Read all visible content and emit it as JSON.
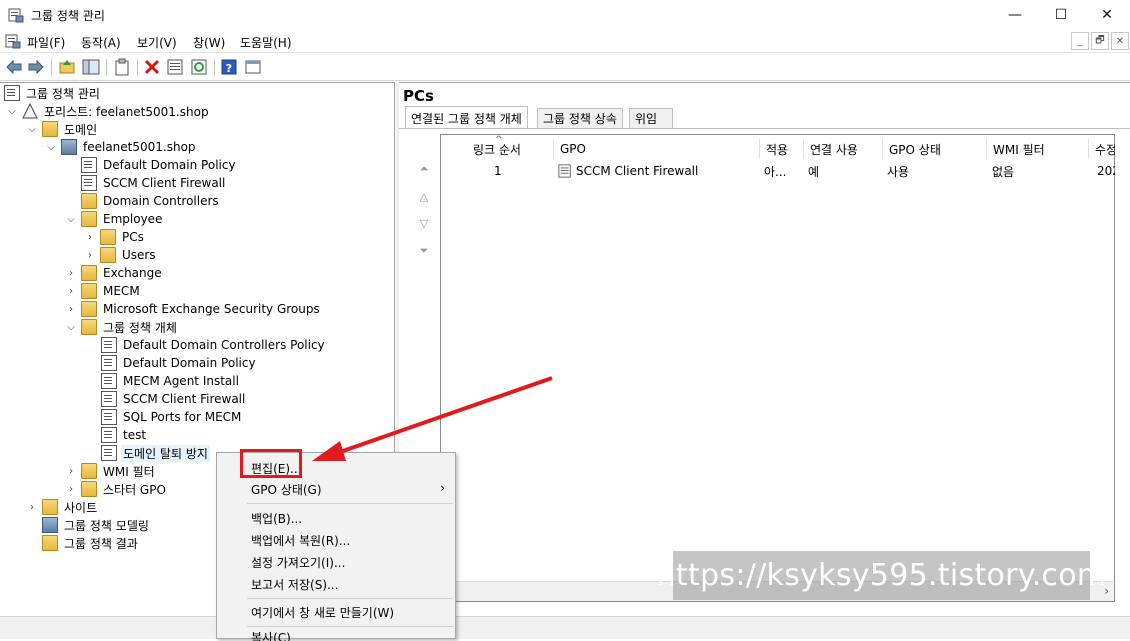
{
  "window": {
    "title": "그룹 정책 관리",
    "controls": {
      "minimize": "—",
      "maximize": "☐",
      "close": "✕"
    }
  },
  "menu": {
    "items": [
      "파일(F)",
      "동작(A)",
      "보기(V)",
      "창(W)",
      "도움말(H)"
    ],
    "mdi_controls": [
      "_",
      "🗗",
      "✕"
    ]
  },
  "toolbar": {
    "icons": [
      "back-icon",
      "forward-icon",
      "up-folder-icon",
      "show-hide-tree-icon",
      "clipboard-icon",
      "delete-icon",
      "properties-icon",
      "refresh-icon",
      "help-icon",
      "view-icon"
    ]
  },
  "tree": {
    "root": "그룹 정책 관리",
    "forest": "포리스트: feelanet5001.shop",
    "domains": "도메인",
    "domain": "feelanet5001.shop",
    "items": {
      "default_domain_policy": "Default Domain Policy",
      "sccm_client_firewall": "SCCM Client Firewall",
      "domain_controllers": "Domain Controllers",
      "employee": "Employee",
      "pcs": "PCs",
      "users": "Users",
      "exchange": "Exchange",
      "mecm": "MECM",
      "msx_security_groups": "Microsoft Exchange Security Groups",
      "gpo_container": "그룹 정책 개체",
      "gpo_ddc": "Default Domain Controllers Policy",
      "gpo_ddp": "Default Domain Policy",
      "gpo_mecm_agent": "MECM Agent Install",
      "gpo_sccm_fw": "SCCM Client Firewall",
      "gpo_sql_ports": "SQL Ports for MECM",
      "gpo_test": "test",
      "gpo_prevent_leave": "도메인 탈퇴 방지",
      "wmi_filters": "WMI 필터",
      "starter_gpo": "스타터 GPO",
      "sites": "사이트",
      "gp_modeling": "그룹 정책 모델링",
      "gp_results": "그룹 정책 결과"
    }
  },
  "right_pane": {
    "title": "PCs",
    "tabs": [
      "연결된 그룹 정책 개체",
      "그룹 정책 상속",
      "위임"
    ],
    "columns": [
      "링크 순서",
      "GPO",
      "적용",
      "연결 사용",
      "GPO 상태",
      "WMI 필터",
      "수정"
    ],
    "rows": [
      {
        "order": "1",
        "gpo": "SCCM Client Firewall",
        "enforced": "아...",
        "link_enabled": "예",
        "gpo_status": "사용",
        "wmi": "없음",
        "modified": "202"
      }
    ]
  },
  "context_menu": {
    "items": {
      "edit": "편집(E)...",
      "gpo_status": "GPO 상태(G)",
      "backup": "백업(B)...",
      "restore": "백업에서 복원(R)...",
      "import": "설정 가져오기(I)...",
      "save_report": "보고서 저장(S)...",
      "new_window": "여기에서 창 새로 만들기(W)",
      "copy": "복사(C)"
    }
  },
  "watermark": "https://ksyksy595.tistory.com",
  "colors": {
    "annotation_red": "#e11b1b",
    "selection": "#e5f3ff"
  }
}
